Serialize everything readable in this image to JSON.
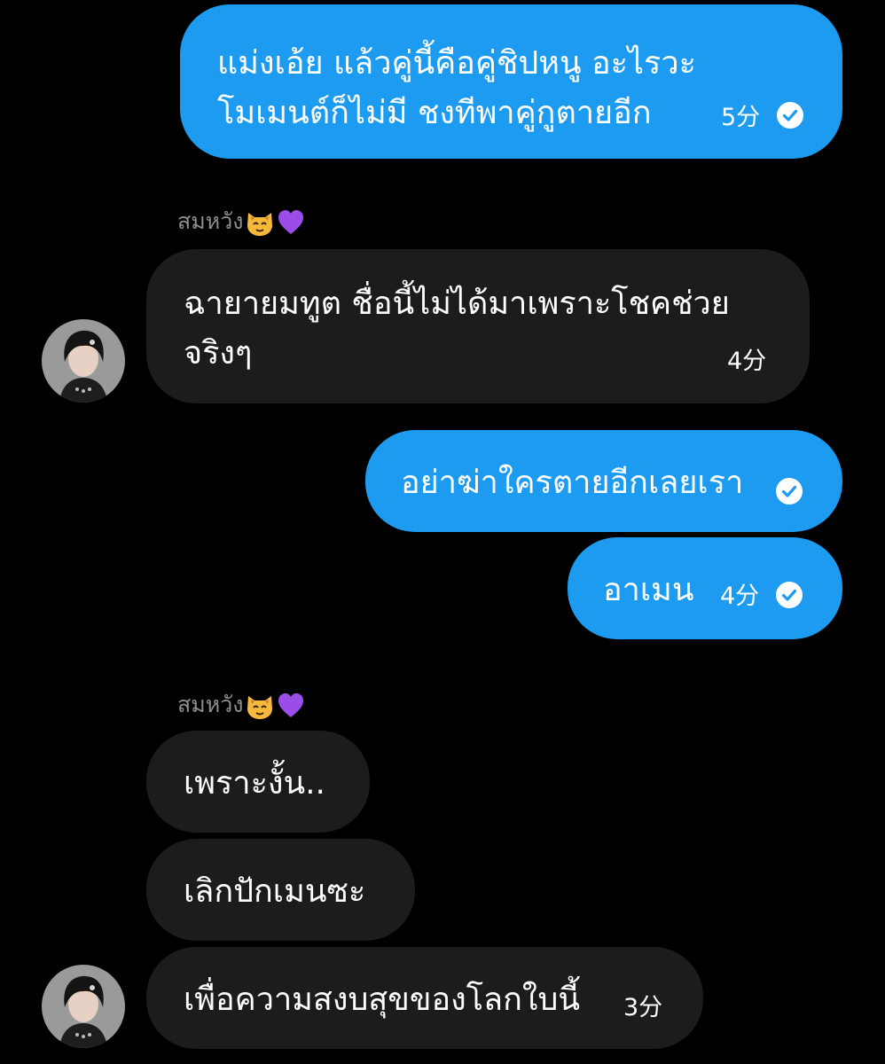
{
  "messages": [
    {
      "lines": [
        "แม่งเอ้ย แล้วคู่นี้คือคู่ชิปหนู อะไรวะ",
        "โมเมนต์ก็ไม่มี ชงทีพาคู่กูตายอีก"
      ],
      "time": "5分"
    },
    {
      "lines": [
        "ฉายายมทูต ชื่อนี้ไม่ได้มาเพราะโชคช่วย",
        "จริงๆ"
      ],
      "time": "4分"
    },
    {
      "text": "อย่าฆ่าใครตายอีกเลยเรา"
    },
    {
      "text": "อาเมน",
      "time": "4分"
    },
    {
      "text": "เพราะงั้น.."
    },
    {
      "text": "เลิกปักเมนซะ"
    },
    {
      "text": "เพื่อความสงบสุขของโลกใบนี้",
      "time": "3分"
    }
  ],
  "senders": [
    {
      "name": "สมหวัง"
    },
    {
      "name": "สมหวัง"
    }
  ],
  "colors": {
    "outgoing_bubble": "#1d9bf0",
    "incoming_bubble": "#1c1c1e",
    "background": "#000000",
    "sender_name": "#8e8e93"
  },
  "icons": [
    "read-check-icon",
    "cat-emoji-icon",
    "purple-heart-emoji-icon",
    "avatar"
  ]
}
